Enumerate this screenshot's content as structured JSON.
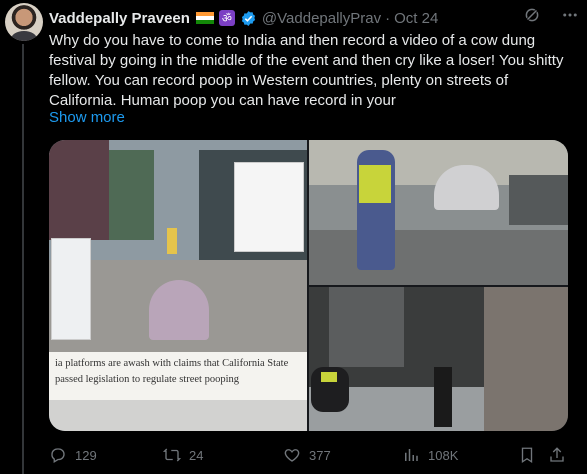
{
  "tweet": {
    "display_name": "Vaddepally Praveen",
    "handle": "@VaddepallyPrav",
    "separator": "·",
    "date": "Oct 24",
    "text": "Why do you have to come to India and then record a video of a cow dung festival by going in the middle of the event and then cry like a loser! You shitty fellow. You can record poop in Western countries, plenty on streets of California. Human poop you can have record in your",
    "show_more": "Show more"
  },
  "media": {
    "image1_caption": "ia platforms are awash with claims that California State passed legislation to regulate street pooping"
  },
  "actions": {
    "replies": "129",
    "reposts": "24",
    "likes": "377",
    "views": "108K"
  },
  "icons": {
    "grok": "grok-icon",
    "more": "more-icon",
    "reply": "reply-icon",
    "repost": "repost-icon",
    "like": "like-icon",
    "views": "views-icon",
    "bookmark": "bookmark-icon",
    "share": "share-icon",
    "verified": "verified-icon",
    "flag": "india-flag-icon",
    "om": "om-icon"
  },
  "colors": {
    "background": "#000000",
    "text": "#e7e9ea",
    "secondary": "#71767b",
    "link": "#1d9bf0",
    "verified": "#1d9bf0"
  }
}
